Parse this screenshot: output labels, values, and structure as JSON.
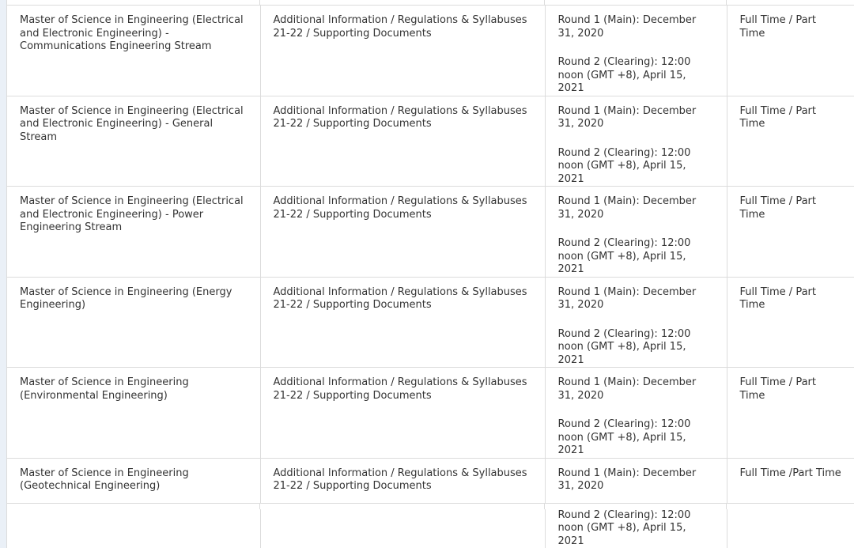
{
  "programmes": [
    {
      "name": "Master of Science in Engineering (Electrical and Electronic Engineering) - Communications Engineering Stream",
      "documents": "Additional Information / Regulations & Syllabuses 21-22 / Supporting Documents",
      "round1": "Round 1 (Main): December 31, 2020",
      "round2": "Round 2 (Clearing): 12:00 noon (GMT +8), April 15, 2021",
      "mode": "Full Time / Part Time"
    },
    {
      "name": "Master of Science in Engineering (Electrical and Electronic Engineering) - General Stream",
      "documents": "Additional Information / Regulations & Syllabuses 21-22 / Supporting Documents",
      "round1": "Round 1 (Main): December 31, 2020",
      "round2": "Round 2 (Clearing): 12:00 noon (GMT +8), April 15, 2021",
      "mode": "Full Time / Part Time"
    },
    {
      "name": "Master of Science in Engineering (Electrical and Electronic Engineering) - Power Engineering Stream",
      "documents": "Additional Information / Regulations & Syllabuses 21-22 / Supporting Documents",
      "round1": "Round 1 (Main): December 31, 2020",
      "round2": "Round 2 (Clearing): 12:00 noon (GMT +8), April 15, 2021",
      "mode": "Full Time / Part Time"
    },
    {
      "name": "Master of Science in Engineering (Energy Engineering)",
      "documents": "Additional Information / Regulations & Syllabuses 21-22 / Supporting Documents",
      "round1": "Round 1 (Main): December 31, 2020",
      "round2": "Round 2 (Clearing): 12:00 noon (GMT +8), April 15, 2021",
      "mode": "Full Time / Part Time"
    },
    {
      "name": "Master of Science in Engineering (Environmental Engineering)",
      "documents": "Additional Information / Regulations & Syllabuses 21-22 / Supporting Documents",
      "round1": "Round 1 (Main): December 31, 2020",
      "round2": "Round 2 (Clearing): 12:00 noon (GMT +8), April 15, 2021",
      "mode": "Full Time / Part Time"
    },
    {
      "name": "Master of Science in Engineering (Geotechnical Engineering)",
      "documents": "Additional Information / Regulations & Syllabuses 21-22 / Supporting Documents",
      "round1": "Round 1 (Main): December 31, 2020",
      "round2": "Round 2 (Clearing): 12:00 noon (GMT +8), April 15, 2021",
      "mode": "Full Time /Part  Time"
    }
  ]
}
